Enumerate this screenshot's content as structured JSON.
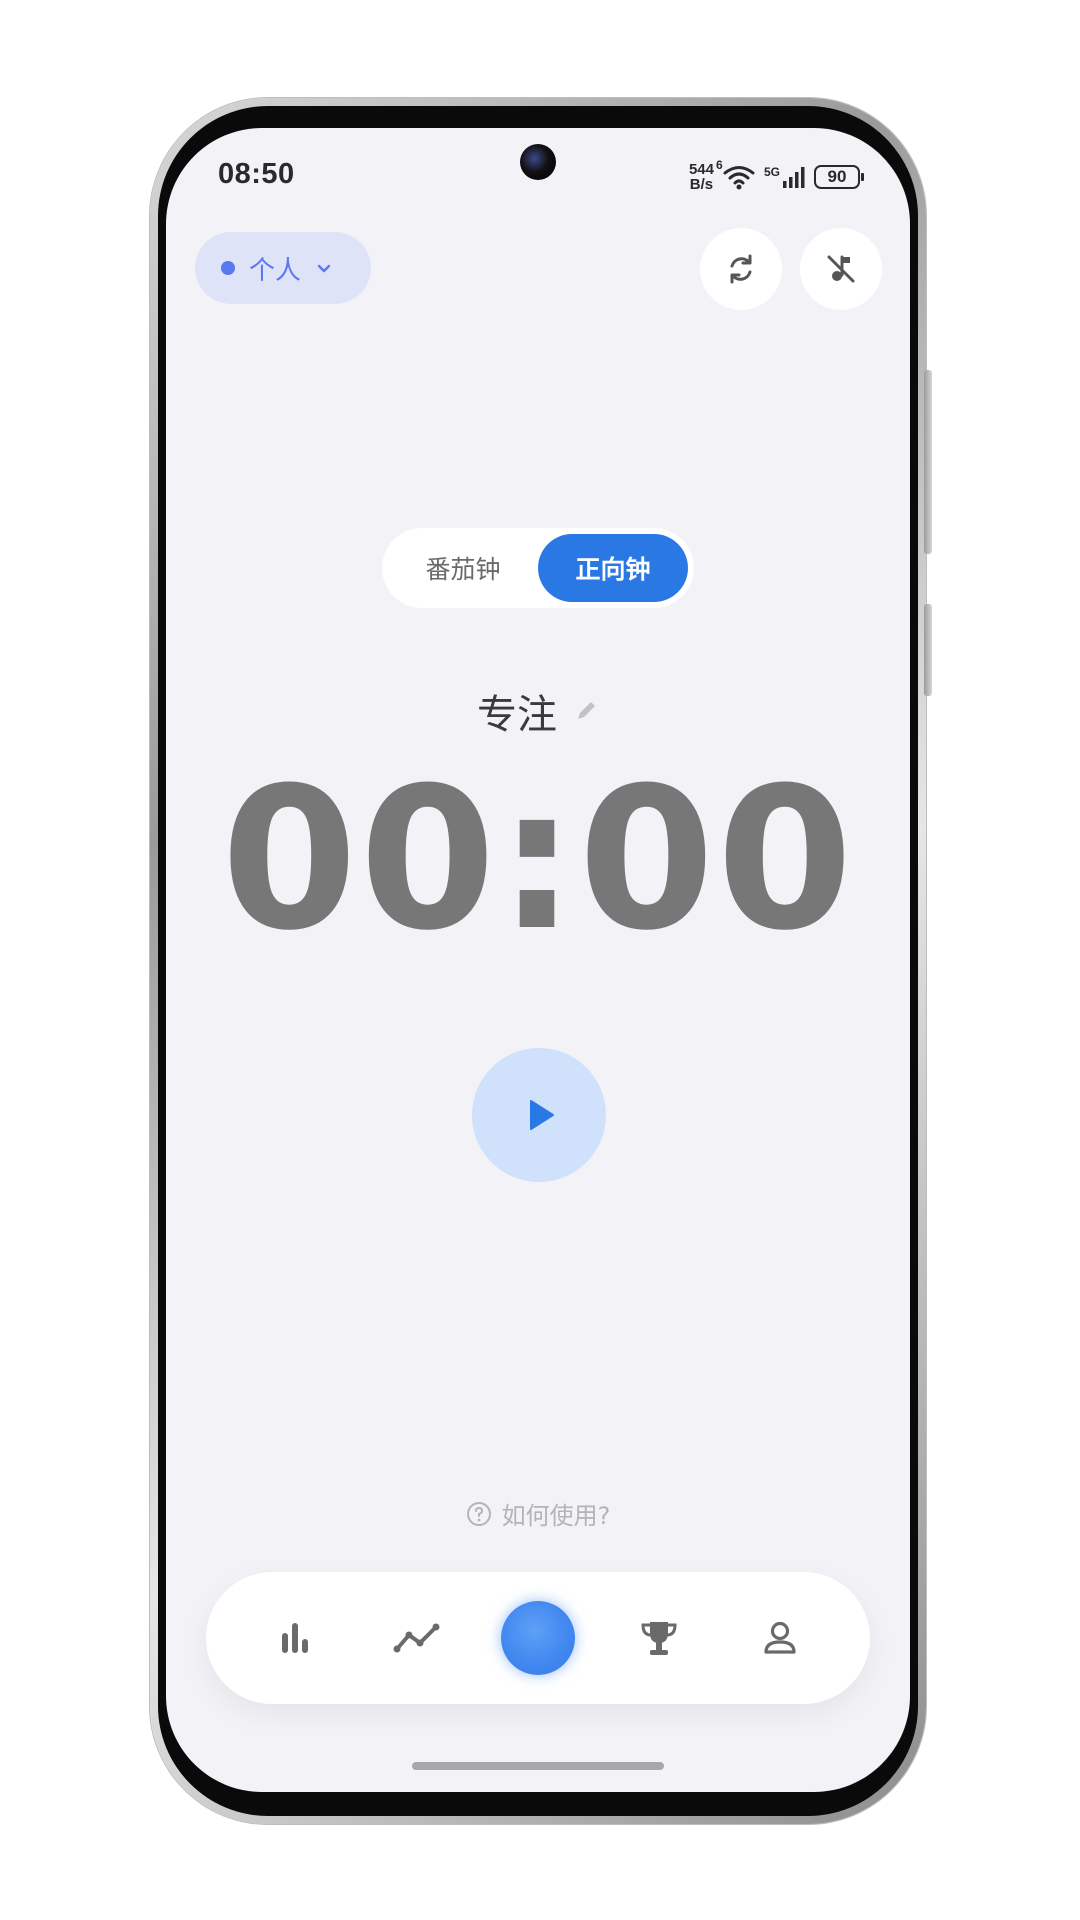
{
  "status_bar": {
    "time": "08:50",
    "net_speed_value": "544",
    "net_speed_unit": "B/s",
    "wifi_badge": "6",
    "cell_badge": "5G",
    "battery": "90"
  },
  "header": {
    "workspace_label": "个人"
  },
  "mode_switch": {
    "options": [
      "番茄钟",
      "正向钟"
    ],
    "selected": "正向钟"
  },
  "timer": {
    "label": "专注",
    "display": "00:00"
  },
  "help": {
    "label": "如何使用?"
  },
  "tabbar": {
    "items": [
      "stats-icon",
      "trend-icon",
      "focus-orb",
      "trophy-icon",
      "profile-icon"
    ],
    "active": "focus-orb"
  },
  "colors": {
    "accent": "#2a78e4",
    "workspace": "#5a78f0",
    "play_bg": "#cfe1fb",
    "background": "#f2f2f7"
  }
}
